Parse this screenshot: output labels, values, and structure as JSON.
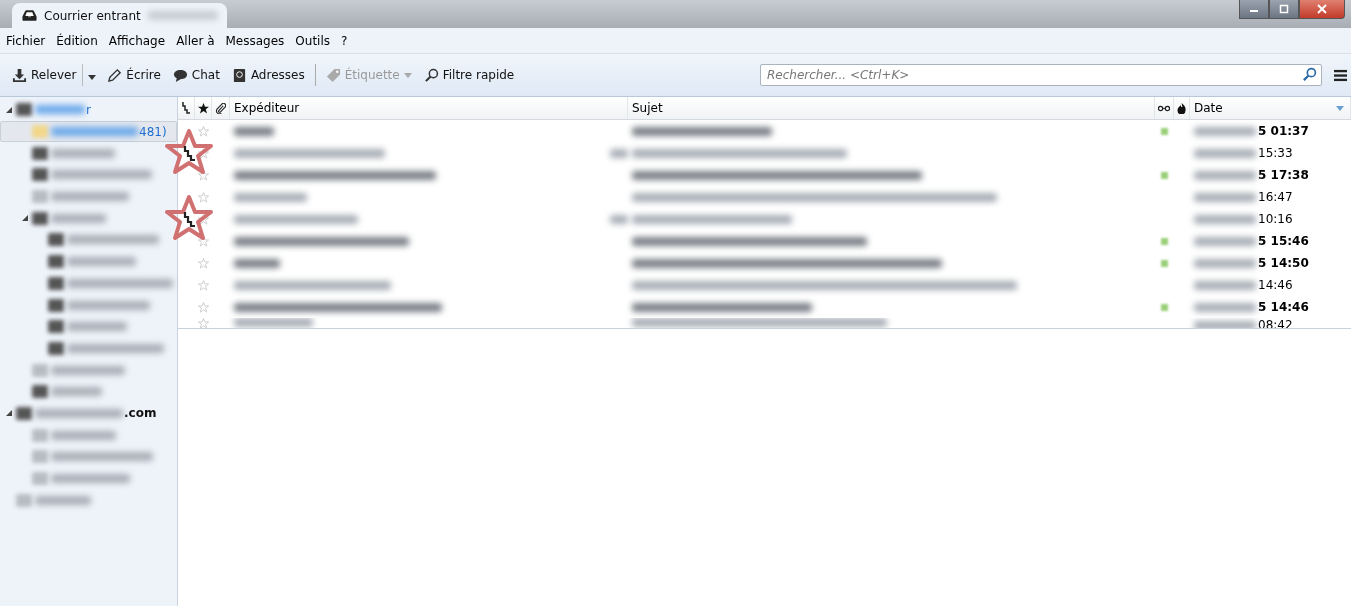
{
  "tab": {
    "title": "Courrier entrant"
  },
  "menu": [
    "Fichier",
    "Édition",
    "Affichage",
    "Aller à",
    "Messages",
    "Outils",
    "?"
  ],
  "toolbar": [
    {
      "kind": "get",
      "label": "Relever",
      "disabled": false
    },
    {
      "kind": "write",
      "label": "Écrire",
      "disabled": false
    },
    {
      "kind": "chat",
      "label": "Chat",
      "disabled": false
    },
    {
      "kind": "addresses",
      "label": "Adresses",
      "disabled": false
    },
    {
      "kind": "tag",
      "label": "Étiquette",
      "disabled": true
    },
    {
      "kind": "filter",
      "label": "Filtre rapide",
      "disabled": false
    }
  ],
  "search": {
    "placeholder": "Rechercher... <Ctrl+K>"
  },
  "folders": [
    {
      "visible_text": "r",
      "kind": "account",
      "expanded": true,
      "children": [
        {
          "visible_text": "481)",
          "kind": "inbox",
          "selected": true
        },
        {
          "kind": "folder",
          "selected": false
        },
        {
          "kind": "folder",
          "selected": false
        },
        {
          "kind": "sent",
          "selected": false
        },
        {
          "kind": "folder",
          "selected": false,
          "expanded": true,
          "children": [
            {
              "kind": "folder",
              "selected": false
            },
            {
              "kind": "folder",
              "selected": false
            },
            {
              "kind": "folder",
              "selected": false
            },
            {
              "kind": "folder",
              "selected": false
            },
            {
              "kind": "folder",
              "selected": false
            },
            {
              "kind": "folder",
              "selected": false
            }
          ]
        },
        {
          "kind": "trash",
          "selected": false
        },
        {
          "kind": "folder",
          "selected": false
        }
      ]
    },
    {
      "visible_text": ".com",
      "kind": "account",
      "expanded": true,
      "children": [
        {
          "kind": "inbox",
          "selected": false
        },
        {
          "kind": "sent",
          "selected": false
        },
        {
          "kind": "trash",
          "selected": false
        }
      ]
    },
    {
      "kind": "local",
      "expanded": false
    }
  ],
  "columns": [
    "Expéditeur",
    "Sujet",
    "Date"
  ],
  "rows": [
    {
      "unread": true,
      "thread": false,
      "annotated": false,
      "date": "5 01:37"
    },
    {
      "unread": false,
      "thread": true,
      "annotated": true,
      "date": "15:33"
    },
    {
      "unread": true,
      "thread": false,
      "annotated": false,
      "date": "5 17:38"
    },
    {
      "unread": false,
      "thread": false,
      "annotated": false,
      "date": "16:47"
    },
    {
      "unread": false,
      "thread": true,
      "annotated": true,
      "date": "10:16"
    },
    {
      "unread": true,
      "thread": false,
      "annotated": false,
      "date": "5 15:46"
    },
    {
      "unread": true,
      "thread": false,
      "annotated": false,
      "date": "5 14:50"
    },
    {
      "unread": false,
      "thread": false,
      "annotated": false,
      "date": "14:46"
    },
    {
      "unread": true,
      "thread": false,
      "annotated": false,
      "date": "5 14:46"
    },
    {
      "unread": false,
      "thread": false,
      "annotated": false,
      "date": "08:42"
    }
  ]
}
